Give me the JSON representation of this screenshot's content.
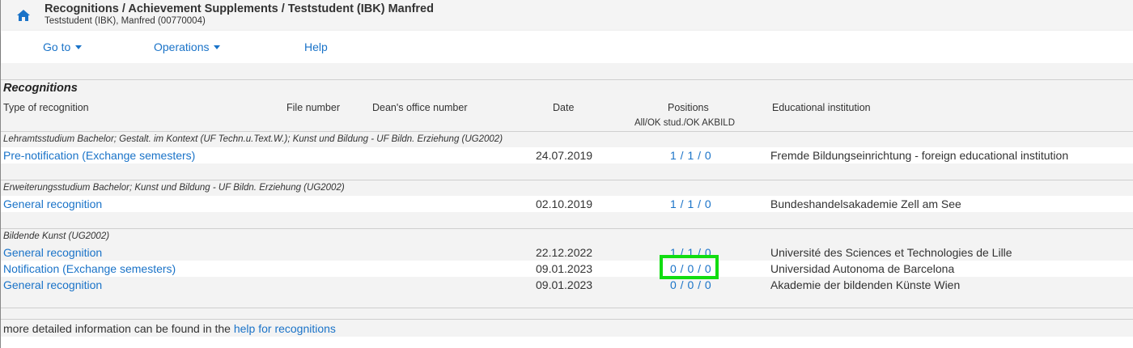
{
  "header": {
    "title": "Recognitions / Achievement Supplements  / Teststudent (IBK) Manfred",
    "subtitle": "Teststudent (IBK), Manfred (00770004)"
  },
  "menu": {
    "goto": "Go to",
    "operations": "Operations",
    "help": "Help"
  },
  "section": {
    "title": "Recognitions",
    "columns": {
      "type": "Type of recognition",
      "file_number": "File number",
      "deans_office_number": "Dean's office number",
      "date": "Date",
      "positions": "Positions",
      "positions_sub": "All/OK stud./OK AKBILD",
      "institution": "Educational institution"
    }
  },
  "groups": [
    {
      "name": "Lehramtsstudium Bachelor; Gestalt. im Kontext (UF Techn.u.Text.W.); Kunst und Bildung - UF Bildn. Erziehung (UG2002)",
      "rows": [
        {
          "type": "Pre-notification (Exchange semesters)",
          "date": "24.07.2019",
          "positions": "1 / 1 / 0",
          "institution": "Fremde Bildungseinrichtung - foreign educational institution"
        }
      ]
    },
    {
      "name": "Erweiterungsstudium Bachelor; Kunst und Bildung - UF Bildn. Erziehung (UG2002)",
      "rows": [
        {
          "type": "General recognition",
          "date": "02.10.2019",
          "positions": "1 / 1 / 0",
          "institution": "Bundeshandelsakademie Zell am See"
        }
      ]
    },
    {
      "name": "Bildende Kunst (UG2002)",
      "rows": [
        {
          "type": "General recognition",
          "date": "22.12.2022",
          "positions": "1 / 1 / 0",
          "institution": "Université des Sciences et Technologies de Lille"
        },
        {
          "type": "Notification (Exchange semesters)",
          "date": "09.01.2023",
          "positions": "0 / 0 / 0",
          "institution": "Universidad Autonoma de Barcelona"
        },
        {
          "type": "General recognition",
          "date": "09.01.2023",
          "positions": "0 / 0 / 0",
          "institution": "Akademie der bildenden Künste Wien"
        }
      ]
    }
  ],
  "footer": {
    "text": "more detailed information can be found in the ",
    "link": "help for recognitions"
  },
  "icons": {
    "home": "home-icon",
    "dropdown": "caret-down-icon"
  },
  "colors": {
    "link": "#1a73c8",
    "highlight": "#11dd11"
  }
}
